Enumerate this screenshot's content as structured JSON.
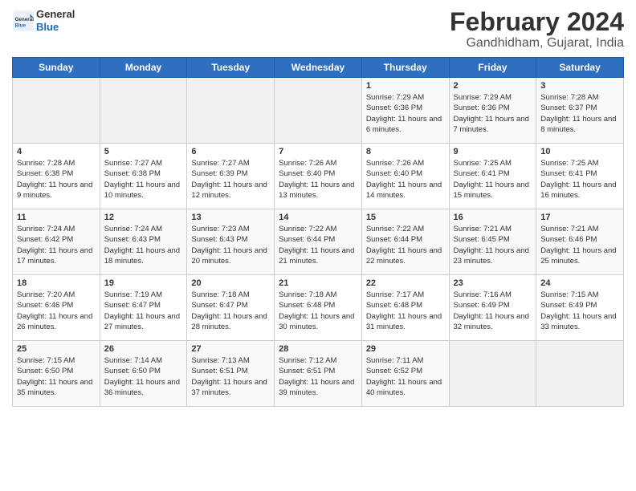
{
  "header": {
    "logo_general": "General",
    "logo_blue": "Blue",
    "title": "February 2024",
    "subtitle": "Gandhidham, Gujarat, India"
  },
  "days_of_week": [
    "Sunday",
    "Monday",
    "Tuesday",
    "Wednesday",
    "Thursday",
    "Friday",
    "Saturday"
  ],
  "weeks": [
    [
      {
        "day": "",
        "empty": true
      },
      {
        "day": "",
        "empty": true
      },
      {
        "day": "",
        "empty": true
      },
      {
        "day": "",
        "empty": true
      },
      {
        "day": "1",
        "sunrise": "7:29 AM",
        "sunset": "6:36 PM",
        "daylight": "11 hours and 6 minutes."
      },
      {
        "day": "2",
        "sunrise": "7:29 AM",
        "sunset": "6:36 PM",
        "daylight": "11 hours and 7 minutes."
      },
      {
        "day": "3",
        "sunrise": "7:28 AM",
        "sunset": "6:37 PM",
        "daylight": "11 hours and 8 minutes."
      }
    ],
    [
      {
        "day": "4",
        "sunrise": "7:28 AM",
        "sunset": "6:38 PM",
        "daylight": "11 hours and 9 minutes."
      },
      {
        "day": "5",
        "sunrise": "7:27 AM",
        "sunset": "6:38 PM",
        "daylight": "11 hours and 10 minutes."
      },
      {
        "day": "6",
        "sunrise": "7:27 AM",
        "sunset": "6:39 PM",
        "daylight": "11 hours and 12 minutes."
      },
      {
        "day": "7",
        "sunrise": "7:26 AM",
        "sunset": "6:40 PM",
        "daylight": "11 hours and 13 minutes."
      },
      {
        "day": "8",
        "sunrise": "7:26 AM",
        "sunset": "6:40 PM",
        "daylight": "11 hours and 14 minutes."
      },
      {
        "day": "9",
        "sunrise": "7:25 AM",
        "sunset": "6:41 PM",
        "daylight": "11 hours and 15 minutes."
      },
      {
        "day": "10",
        "sunrise": "7:25 AM",
        "sunset": "6:41 PM",
        "daylight": "11 hours and 16 minutes."
      }
    ],
    [
      {
        "day": "11",
        "sunrise": "7:24 AM",
        "sunset": "6:42 PM",
        "daylight": "11 hours and 17 minutes."
      },
      {
        "day": "12",
        "sunrise": "7:24 AM",
        "sunset": "6:43 PM",
        "daylight": "11 hours and 18 minutes."
      },
      {
        "day": "13",
        "sunrise": "7:23 AM",
        "sunset": "6:43 PM",
        "daylight": "11 hours and 20 minutes."
      },
      {
        "day": "14",
        "sunrise": "7:22 AM",
        "sunset": "6:44 PM",
        "daylight": "11 hours and 21 minutes."
      },
      {
        "day": "15",
        "sunrise": "7:22 AM",
        "sunset": "6:44 PM",
        "daylight": "11 hours and 22 minutes."
      },
      {
        "day": "16",
        "sunrise": "7:21 AM",
        "sunset": "6:45 PM",
        "daylight": "11 hours and 23 minutes."
      },
      {
        "day": "17",
        "sunrise": "7:21 AM",
        "sunset": "6:46 PM",
        "daylight": "11 hours and 25 minutes."
      }
    ],
    [
      {
        "day": "18",
        "sunrise": "7:20 AM",
        "sunset": "6:46 PM",
        "daylight": "11 hours and 26 minutes."
      },
      {
        "day": "19",
        "sunrise": "7:19 AM",
        "sunset": "6:47 PM",
        "daylight": "11 hours and 27 minutes."
      },
      {
        "day": "20",
        "sunrise": "7:18 AM",
        "sunset": "6:47 PM",
        "daylight": "11 hours and 28 minutes."
      },
      {
        "day": "21",
        "sunrise": "7:18 AM",
        "sunset": "6:48 PM",
        "daylight": "11 hours and 30 minutes."
      },
      {
        "day": "22",
        "sunrise": "7:17 AM",
        "sunset": "6:48 PM",
        "daylight": "11 hours and 31 minutes."
      },
      {
        "day": "23",
        "sunrise": "7:16 AM",
        "sunset": "6:49 PM",
        "daylight": "11 hours and 32 minutes."
      },
      {
        "day": "24",
        "sunrise": "7:15 AM",
        "sunset": "6:49 PM",
        "daylight": "11 hours and 33 minutes."
      }
    ],
    [
      {
        "day": "25",
        "sunrise": "7:15 AM",
        "sunset": "6:50 PM",
        "daylight": "11 hours and 35 minutes."
      },
      {
        "day": "26",
        "sunrise": "7:14 AM",
        "sunset": "6:50 PM",
        "daylight": "11 hours and 36 minutes."
      },
      {
        "day": "27",
        "sunrise": "7:13 AM",
        "sunset": "6:51 PM",
        "daylight": "11 hours and 37 minutes."
      },
      {
        "day": "28",
        "sunrise": "7:12 AM",
        "sunset": "6:51 PM",
        "daylight": "11 hours and 39 minutes."
      },
      {
        "day": "29",
        "sunrise": "7:11 AM",
        "sunset": "6:52 PM",
        "daylight": "11 hours and 40 minutes."
      },
      {
        "day": "",
        "empty": true
      },
      {
        "day": "",
        "empty": true
      }
    ]
  ],
  "labels": {
    "sunrise": "Sunrise:",
    "sunset": "Sunset:",
    "daylight": "Daylight:"
  }
}
